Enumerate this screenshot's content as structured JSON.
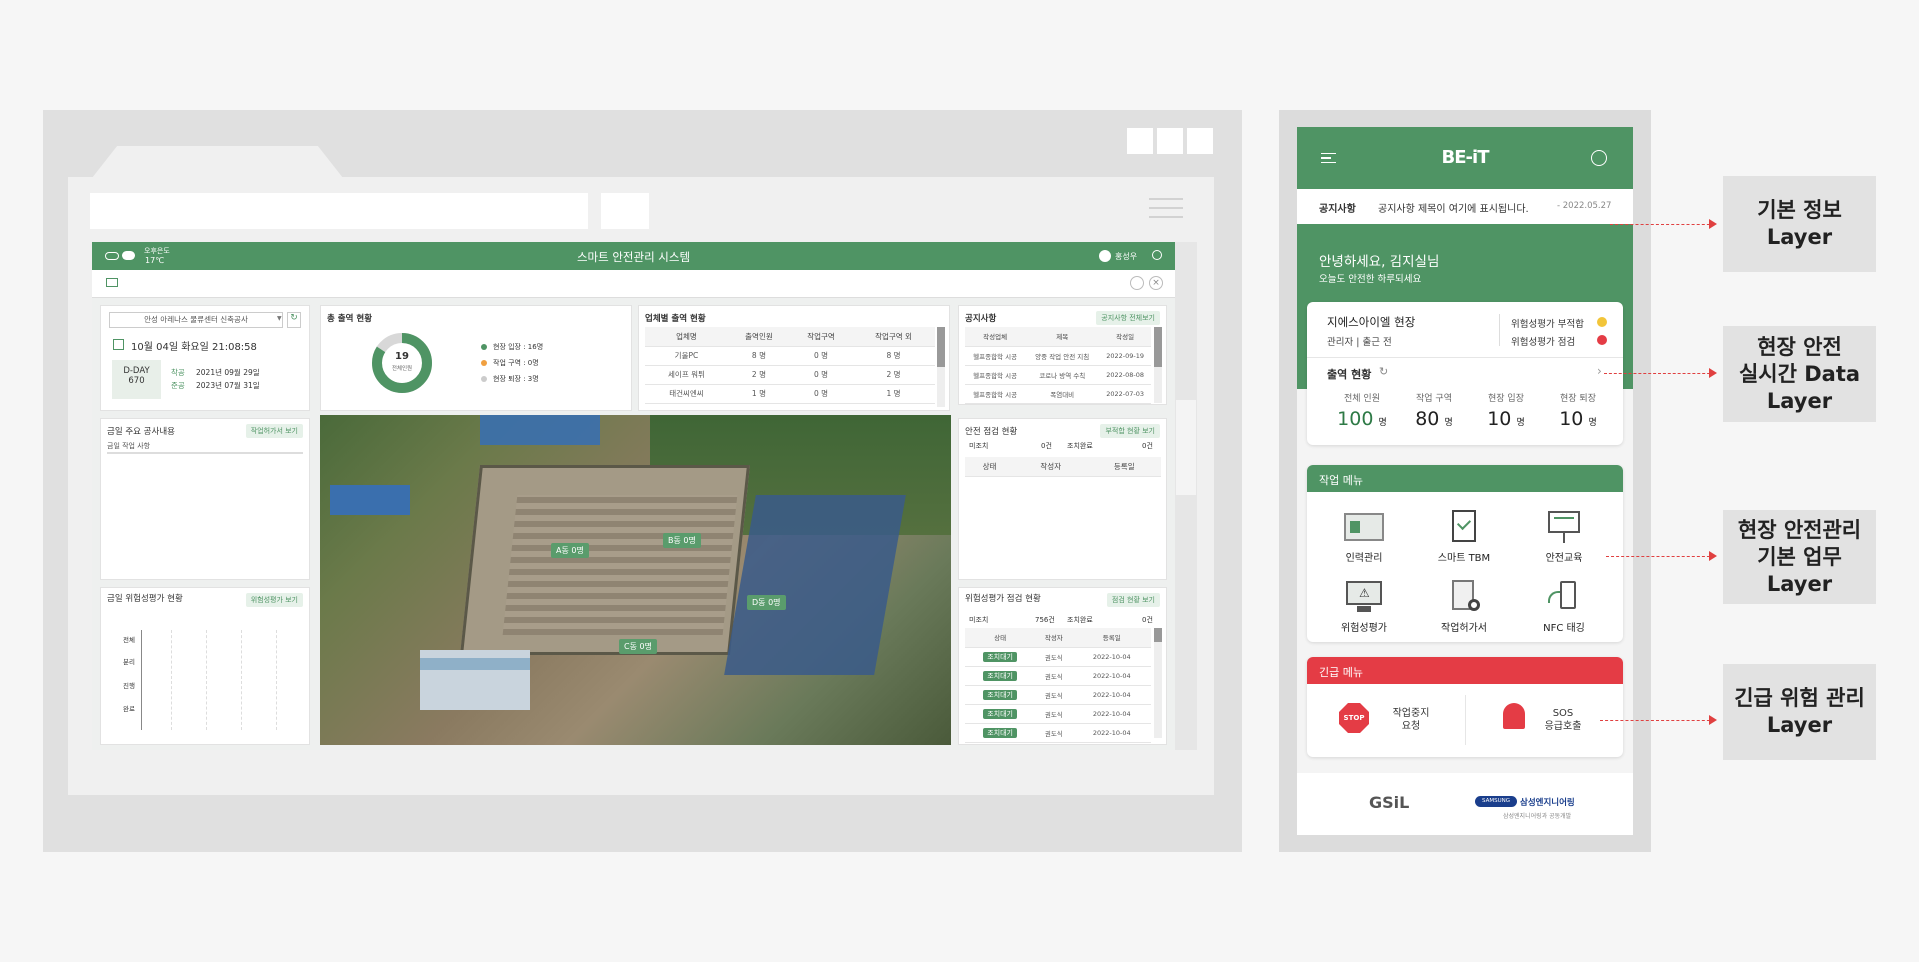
{
  "dashboard": {
    "weather_line1": "오후은도",
    "weather_line2": "17℃",
    "title": "스마트 안전관리 시스템",
    "user": "홍성우",
    "site_select": "안성 아레나스 물류센터 신축공사",
    "datetime": "10월 04일 화요일 21:08:58",
    "dday_label": "D-DAY",
    "dday_value": "670",
    "start_label": "착공",
    "start_date": "2021년 09월 29일",
    "end_label": "준공",
    "end_date": "2023년 07월 31일",
    "attendance_title": "총 출역 현황",
    "donut_total": "19",
    "donut_label": "전체인원",
    "legend": [
      "현장 입장 : 16명",
      "작업 구역 : 0명",
      "현장 퇴장 : 3명"
    ],
    "company_title": "업체별 출역 현황",
    "company_headers": [
      "업체명",
      "출역인원",
      "작업구역",
      "작업구역 외"
    ],
    "company_rows": [
      [
        "기울PC",
        "8 명",
        "0 명",
        "8 명"
      ],
      [
        "세이프 워튀",
        "2 명",
        "0 명",
        "2 명"
      ],
      [
        "태건씨엔씨",
        "1 명",
        "0 명",
        "1 명"
      ]
    ],
    "notice_title": "공지사항",
    "notice_btn": "공지사항 전체보기",
    "notice_headers": [
      "작성업체",
      "제목",
      "작성일"
    ],
    "notice_rows": [
      [
        "헬프종합학 시공",
        "양중 작업 안전 지침",
        "2022-09-19"
      ],
      [
        "헬프종합학 시공",
        "코로나 방역 수칙",
        "2022-08-08"
      ],
      [
        "헬프종합학 시공",
        "폭염대비",
        "2022-07-03"
      ]
    ],
    "work_title": "금일 주요 공사내용",
    "work_btn": "작업허가서 보기",
    "work_sub": "금일 작업 사항",
    "risk_title": "금일 위험성평가 현황",
    "risk_btn": "위험성평가 보기",
    "risk_axis": [
      "전체",
      "분리",
      "진행",
      "완료"
    ],
    "safety_title": "안전 점검 현황",
    "safety_btn": "부적합 현황 보기",
    "safety_row": [
      "미조치",
      "0건",
      "조치완료",
      "0건"
    ],
    "safety_headers": [
      "상태",
      "작성자",
      "등록일"
    ],
    "riskcheck_title": "위험성평가 점검 현황",
    "riskcheck_btn": "점검 현황 보기",
    "riskcheck_row": [
      "미조치",
      "756건",
      "조치완료",
      "0건"
    ],
    "riskcheck_headers": [
      "상태",
      "작성자",
      "등록일"
    ],
    "riskcheck_rows": [
      [
        "조치대기",
        "권도식",
        "2022-10-04"
      ],
      [
        "조치대기",
        "권도식",
        "2022-10-04"
      ],
      [
        "조치대기",
        "권도식",
        "2022-10-04"
      ],
      [
        "조치대기",
        "권도식",
        "2022-10-04"
      ],
      [
        "조치대기",
        "권도식",
        "2022-10-04"
      ]
    ],
    "zones": [
      "A동 0명",
      "B동 0명",
      "C동 0명",
      "D동 0명"
    ]
  },
  "mobile": {
    "logo": "BE-iT",
    "notice_label": "공지사항",
    "notice_text": "공지사항 제목이 여기에 표시됩니다.",
    "notice_date": "- 2022.05.27",
    "greeting": "안녕하세요, 김지실님",
    "greeting_sub": "오늘도 안전한 하루되세요",
    "site_name": "지에스아이엘 현장",
    "role": "관리자 | 출근 전",
    "risk1": "위험성평가 부적합",
    "risk2": "위험성평가 점검",
    "attendance_label": "출역 현황",
    "stats": [
      {
        "label": "전체 인원",
        "value": "100",
        "unit": "명"
      },
      {
        "label": "작업 구역",
        "value": "80",
        "unit": "명"
      },
      {
        "label": "현장 입장",
        "value": "10",
        "unit": "명"
      },
      {
        "label": "현장 퇴장",
        "value": "10",
        "unit": "명"
      }
    ],
    "work_menu_title": "작업 메뉴",
    "work_menu": [
      "인력관리",
      "스마트 TBM",
      "안전교육",
      "위험성평가",
      "작업허가서",
      "NFC 태깅"
    ],
    "emergency_title": "긴급 메뉴",
    "emergency1_line1": "작업중지",
    "emergency1_line2": "요청",
    "stop_text": "STOP",
    "emergency2_line1": "SOS",
    "emergency2_line2": "응급호출",
    "footer_logo1": "GSiL",
    "footer_logo2_brand": "SAMSUNG",
    "footer_logo2": "삼성엔지니어링",
    "footer_logo2_sub": "삼성엔지니어링과 공동개발"
  },
  "layers": [
    {
      "line1": "기본 정보",
      "line2": "Layer"
    },
    {
      "line1": "현장 안전",
      "line2": "실시간 Data",
      "line3": "Layer"
    },
    {
      "line1": "현장 안전관리",
      "line2": "기본 업무",
      "line3": "Layer"
    },
    {
      "line1": "긴급 위험 관리",
      "line2": "Layer"
    }
  ],
  "colors": {
    "brand_green": "#4f9464",
    "emergency_red": "#e43c45",
    "arrow_red": "#e04040"
  }
}
